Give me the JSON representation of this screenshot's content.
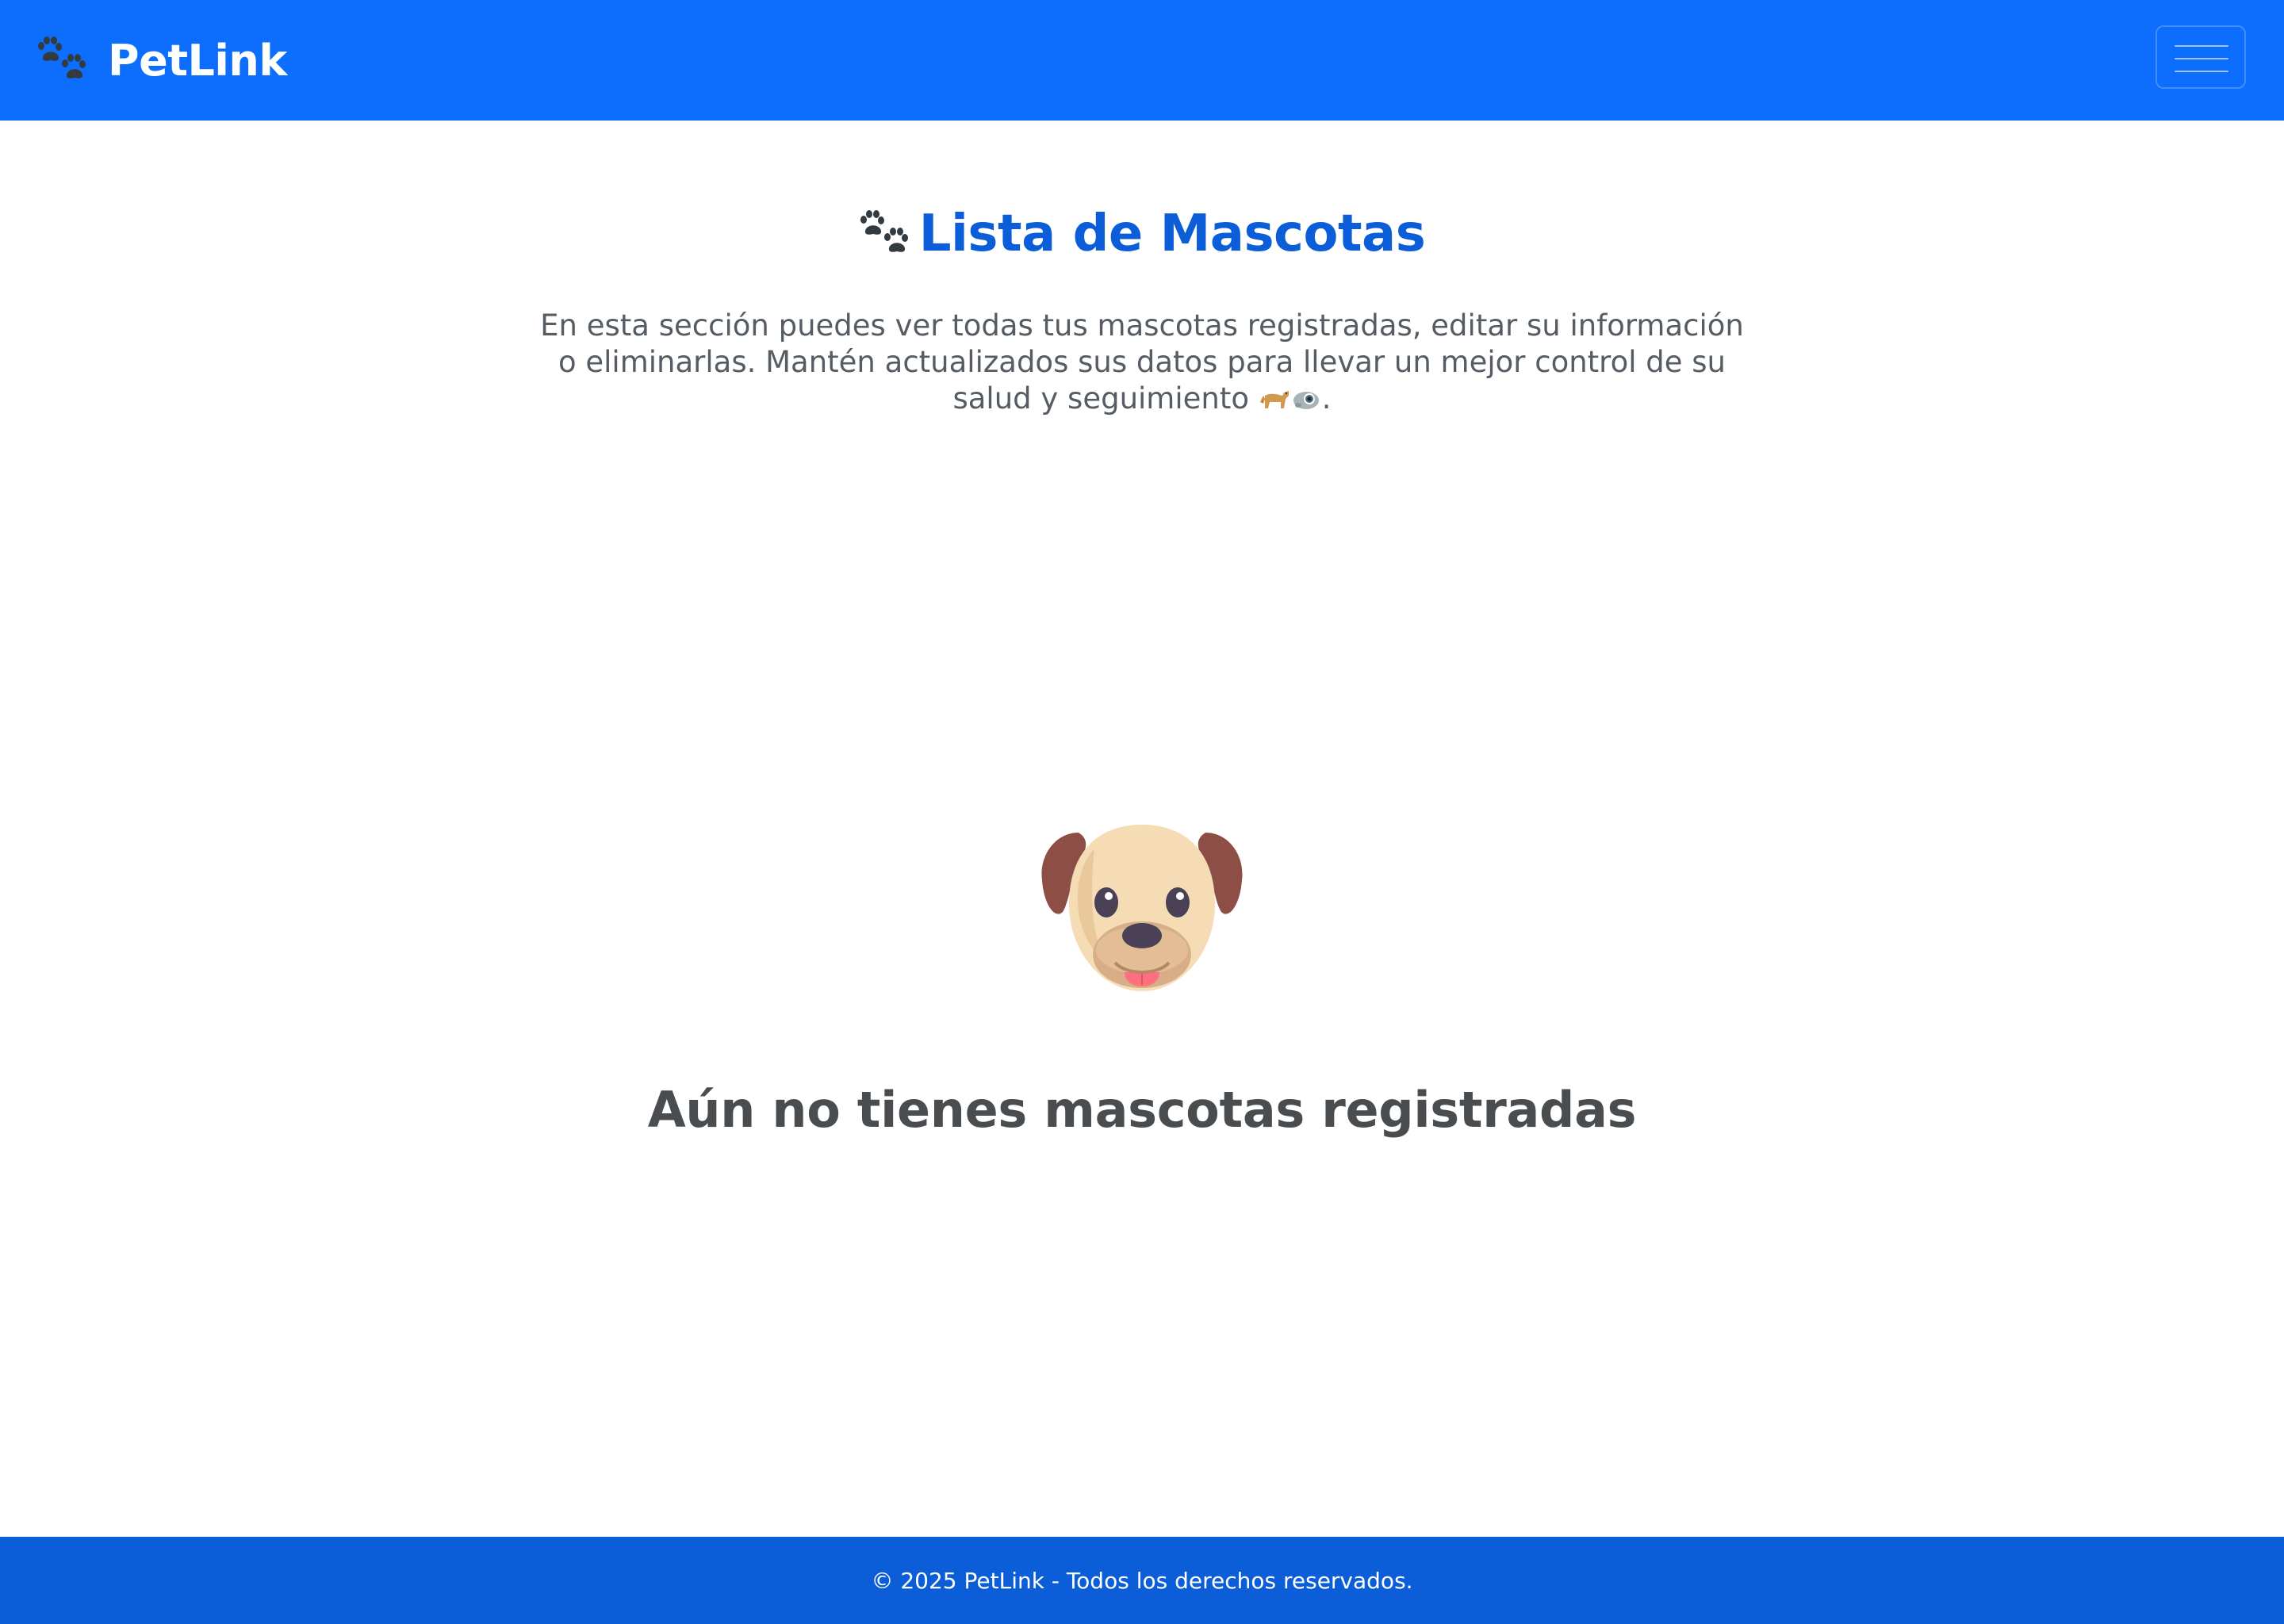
{
  "navbar": {
    "brand": "PetLink",
    "brand_icon": "paw-prints-icon",
    "toggler_icon": "hamburger-menu-icon",
    "background_color": "#0d6efd"
  },
  "main": {
    "title": "Lista de Mascotas",
    "title_icon": "paw-prints-icon",
    "title_color": "#0b5ed7",
    "description": "En esta sección puedes ver todas tus mascotas registradas, editar su información o eliminarlas. Mantén actualizados sus datos para llevar un mejor control de su salud y seguimiento",
    "description_end": ".",
    "description_icons": [
      "dog-icon",
      "cat-icon"
    ],
    "empty_state": {
      "icon": "dog-face-icon",
      "message": "Aún no tienes mascotas registradas"
    }
  },
  "footer": {
    "text": "© 2025 PetLink - Todos los derechos reservados.",
    "background_color": "#0b5ed7"
  }
}
